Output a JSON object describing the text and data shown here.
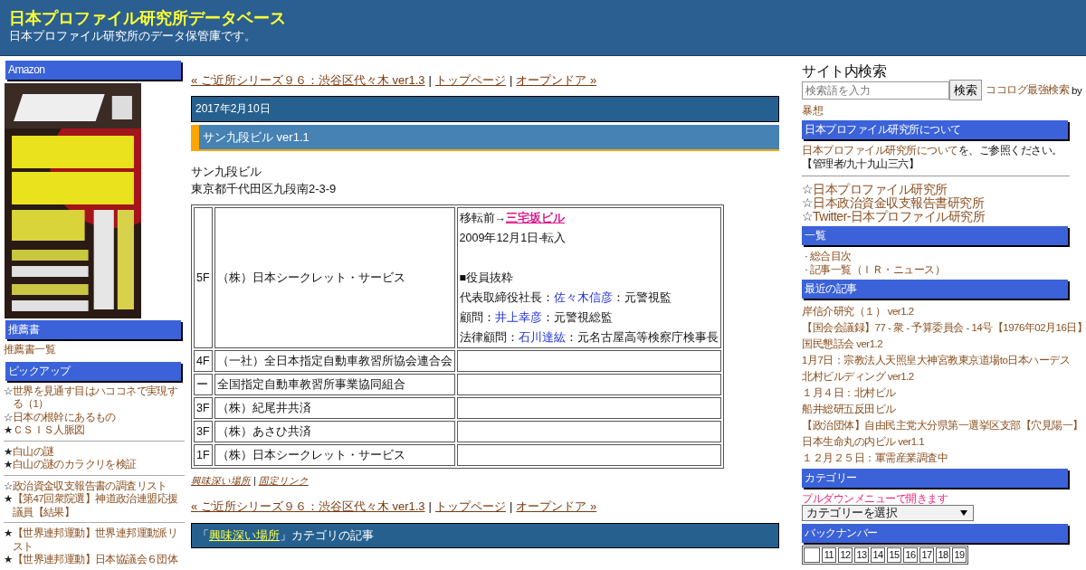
{
  "header": {
    "title": "日本プロファイル研究所データベース",
    "subtitle": "日本プロファイル研究所のデータ保管庫です。"
  },
  "left_sidebar": [
    {
      "heading": "Amazon",
      "kind": "picture"
    },
    {
      "heading": "推薦書",
      "kind": "links",
      "groups": [
        [
          {
            "text": "推薦書一覧"
          }
        ]
      ]
    },
    {
      "heading": "ピックアップ",
      "kind": "links",
      "groups": [
        [
          {
            "mark": "☆",
            "text": "世界を見通す目はハココネで実現する（1）"
          },
          {
            "mark": "☆",
            "text": "日本の根幹にあるもの"
          },
          {
            "mark": "★",
            "text": "ＣＳＩＳ人脈図"
          }
        ],
        [
          {
            "mark": "★",
            "text": "白山の謎"
          },
          {
            "mark": "★",
            "text": "白山の謎のカラクリを検証"
          }
        ],
        [
          {
            "mark": "☆",
            "text": "政治資金収支報告書の調査リスト"
          },
          {
            "mark": "★",
            "text": "【第47回衆院選】神道政治連盟応援議員【結果】"
          }
        ],
        [
          {
            "mark": "★",
            "text": "【世界連邦運動】世界連邦運動派リスト"
          },
          {
            "mark": "★",
            "text": "【世界連邦運動】日本協議会６団体"
          }
        ]
      ]
    }
  ],
  "main": {
    "nav": {
      "prev": "« ご近所シリーズ９６：渋谷区代々木 ver1.3",
      "separator": "|",
      "top": "トップページ",
      "next": "オープンドア »"
    },
    "date": "2017年2月10日",
    "title": "サン九段ビル ver1.1",
    "body": [
      "サン九段ビル",
      "東京都千代田区九段南2-3-9"
    ],
    "table": [
      {
        "floor": "5F",
        "tenant": "（株）日本シークレット・サービス",
        "notes": [
          {
            "kind": "text",
            "segments": [
              {
                "kind": "plain",
                "text": "移転前→"
              },
              {
                "kind": "strong-link",
                "text": "三宅坂ビル"
              }
            ]
          },
          {
            "kind": "text",
            "segments": [
              {
                "kind": "plain",
                "text": "2009年12月1日-転入"
              }
            ]
          },
          {
            "kind": "blank"
          },
          {
            "kind": "text",
            "segments": [
              {
                "kind": "plain",
                "text": "■役員抜粋"
              }
            ]
          },
          {
            "kind": "text",
            "segments": [
              {
                "kind": "plain",
                "text": "代表取締役社長："
              },
              {
                "kind": "link",
                "text": "佐々木信彦"
              },
              {
                "kind": "plain",
                "text": "：元警視監"
              }
            ]
          },
          {
            "kind": "text",
            "segments": [
              {
                "kind": "plain",
                "text": "顧問："
              },
              {
                "kind": "link",
                "text": "井上幸彦"
              },
              {
                "kind": "plain",
                "text": "：元警視総監"
              }
            ]
          },
          {
            "kind": "text",
            "segments": [
              {
                "kind": "plain",
                "text": "法律顧問："
              },
              {
                "kind": "link",
                "text": "石川達紘"
              },
              {
                "kind": "plain",
                "text": "：元名古屋高等検察庁検事長"
              }
            ]
          }
        ]
      },
      {
        "floor": "4F",
        "tenant": "（一社）全日本指定自動車教習所協会連合会"
      },
      {
        "floor": "ー",
        "tenant": "全国指定自動車教習所事業協同組合"
      },
      {
        "floor": "3F",
        "tenant": "（株）紀尾井共済"
      },
      {
        "floor": "3F",
        "tenant": "（株）あさひ共済"
      },
      {
        "floor": "1F",
        "tenant": "（株）日本シークレット・サービス"
      }
    ],
    "post_footer": {
      "category": "興味深い場所",
      "separator": "|",
      "permalink": "固定リンク"
    },
    "nav_bottom": {
      "prev": "« ご近所シリーズ９６：渋谷区代々木 ver1.3",
      "separator": "|",
      "top": "トップページ",
      "next": "オープンドア »"
    },
    "category_box": {
      "open": "「",
      "link": "興味深い場所",
      "rest": "」カテゴリの記事"
    }
  },
  "right_sidebar": {
    "search": {
      "title": "サイト内検索",
      "placeholder": "検索語を入力",
      "button": "検索",
      "link": "ココログ最強検索",
      "by": "by",
      "author": "暴想"
    },
    "about": {
      "heading": "日本プロファイル研究所について",
      "link": "日本プロファイル研究所について",
      "rest": "を、ご参照ください。",
      "admin": "【管理者/九十九山三六】"
    },
    "big_links": [
      {
        "mark": "☆",
        "text": "日本プロファイル研究所"
      },
      {
        "mark": "☆",
        "text": "日本政治資金収支報告書研究所"
      },
      {
        "mark": "☆",
        "text": "Twitter-日本プロファイル研究所"
      }
    ],
    "index": {
      "heading": "一覧",
      "items": [
        {
          "mark": "·",
          "text": "総合目次"
        },
        {
          "mark": "·",
          "text": "記事一覧（ＩＲ・ニュース）"
        }
      ]
    },
    "recent": {
      "heading": "最近の記事",
      "items": [
        "岸信介研究（１） ver1.2",
        "【国会会議録】77 - 衆 - 予算委員会 - 14号【1976年02月16日】",
        "国民懇話会 ver1.2",
        "1月7日：宗教法人天照皇大神宮教東京道場to日本ハーデス",
        "北村ビルディング ver1.2",
        "１月４日：北村ビル",
        "船井総研五反田ビル",
        "【政治団体】自由民主党大分県第一選挙区支部【穴見陽一】",
        "日本生命丸の内ビル ver1.1",
        "１２月２５日：軍需産業調査中"
      ]
    },
    "category": {
      "heading": "カテゴリー",
      "note": "プルダウンメニューで開きます",
      "select": "カテゴリーを選択"
    },
    "backnumber": {
      "heading": "バックナンバー",
      "cells": [
        "11",
        "12",
        "13",
        "14",
        "15",
        "16",
        "17",
        "18",
        "19"
      ]
    }
  }
}
